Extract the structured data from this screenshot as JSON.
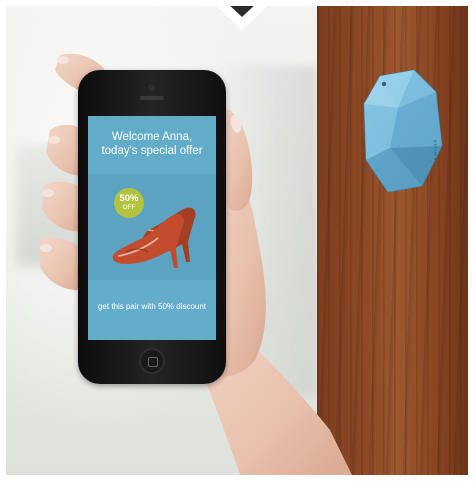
{
  "screen": {
    "welcome_line1": "Welcome Anna,",
    "welcome_line2": "today's special offer",
    "badge_percent": "50%",
    "badge_off": "OFF",
    "discount_text": "get this pair with 50% discount"
  },
  "colors": {
    "screen_blue": "#5fa8c8",
    "badge_green": "#b3c33f",
    "beacon_blue": "#74b5d6",
    "shoe_red": "#b8472a",
    "wood": "#8e4a26"
  },
  "icons": {
    "notch": "chevron-down-icon",
    "home": "home-button-icon"
  }
}
